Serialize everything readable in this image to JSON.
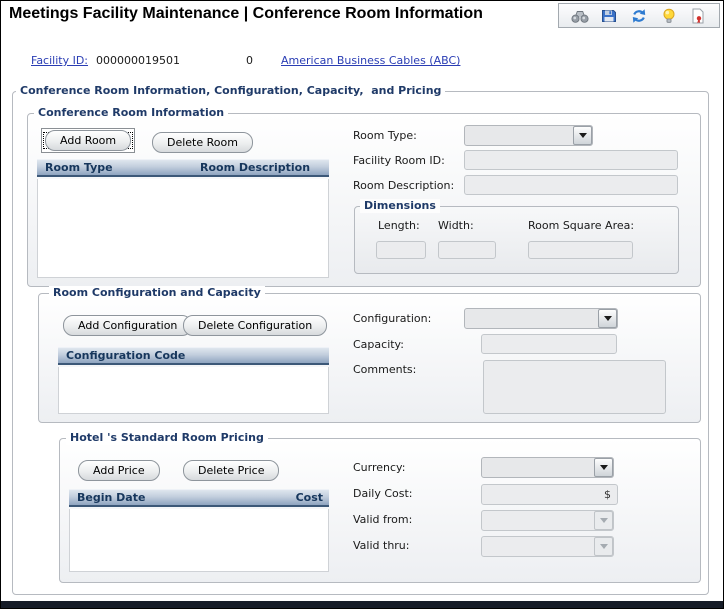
{
  "header": {
    "title": "Meetings Facility Maintenance | Conference Room Information",
    "toolbar_icons": [
      "find-binoculars",
      "save",
      "refresh",
      "hint-lightbulb",
      "report"
    ]
  },
  "facility": {
    "id_label": "Facility ID:",
    "id_value": "000000019501",
    "secondary_value": "0",
    "name_link": "American Business Cables (ABC)"
  },
  "outer_section": {
    "title": "Conference Room Information, Configuration, Capacity,  and Pricing"
  },
  "room_info": {
    "title": "Conference Room Information",
    "add_button": "Add Room",
    "delete_button": "Delete Room",
    "table": {
      "columns": [
        "Room Type",
        "Room Description"
      ],
      "rows": []
    },
    "fields": {
      "room_type_label": "Room Type:",
      "room_type_value": "",
      "facility_room_id_label": "Facility Room ID:",
      "facility_room_id_value": "",
      "room_description_label": "Room Description:",
      "room_description_value": ""
    },
    "dimensions": {
      "title": "Dimensions",
      "length_label": "Length:",
      "length_value": "",
      "width_label": "Width:",
      "width_value": "",
      "area_label": "Room Square Area:",
      "area_value": ""
    }
  },
  "config_capacity": {
    "title": "Room Configuration and Capacity",
    "add_button": "Add Configuration",
    "delete_button": "Delete Configuration",
    "table": {
      "columns": [
        "Configuration Code"
      ],
      "rows": []
    },
    "fields": {
      "configuration_label": "Configuration:",
      "configuration_value": "",
      "capacity_label": "Capacity:",
      "capacity_value": "",
      "comments_label": "Comments:",
      "comments_value": ""
    }
  },
  "pricing": {
    "title": "Hotel 's Standard Room Pricing",
    "add_button": "Add Price",
    "delete_button": "Delete Price",
    "table": {
      "columns": [
        "Begin Date",
        "Cost"
      ],
      "rows": []
    },
    "fields": {
      "currency_label": "Currency:",
      "currency_value": "",
      "daily_cost_label": "Daily Cost:",
      "daily_cost_value": "",
      "daily_cost_suffix": "$",
      "valid_from_label": "Valid from:",
      "valid_from_value": "",
      "valid_thru_label": "Valid thru:",
      "valid_thru_value": ""
    }
  },
  "colors": {
    "legend_navy": "#1f3a68",
    "link_blue": "#2a3db4",
    "table_header_text": "#16365c",
    "table_header_gradient_top": "#dfe6ee",
    "table_header_gradient_bottom": "#8fa5c0",
    "bottom_bar": "#161c28"
  }
}
